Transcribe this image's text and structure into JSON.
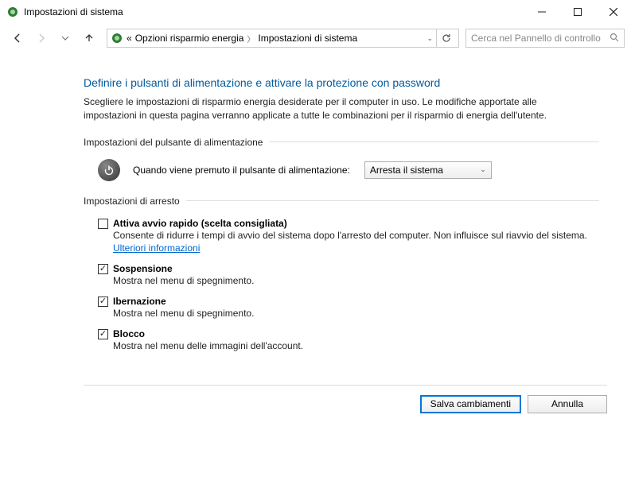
{
  "window": {
    "title": "Impostazioni di sistema"
  },
  "breadcrumb": {
    "prefix": "«",
    "item1": "Opzioni risparmio energia",
    "item2": "Impostazioni di sistema"
  },
  "search": {
    "placeholder": "Cerca nel Pannello di controllo"
  },
  "heading": "Definire i pulsanti di alimentazione e attivare la protezione con password",
  "description": "Scegliere le impostazioni di risparmio energia desiderate per il computer in uso. Le modifiche apportate alle impostazioni in questa pagina verranno applicate a tutte le combinazioni per il risparmio di energia dell'utente.",
  "section_power": {
    "header": "Impostazioni del pulsante di alimentazione",
    "label": "Quando viene premuto il pulsante di alimentazione:",
    "value": "Arresta il sistema"
  },
  "section_shutdown": {
    "header": "Impostazioni di arresto",
    "options": [
      {
        "title": "Attiva avvio rapido (scelta consigliata)",
        "desc": "Consente di ridurre i tempi di avvio del sistema dopo l'arresto del computer. Non influisce sul riavvio del sistema. ",
        "link": "Ulteriori informazioni",
        "checked": false
      },
      {
        "title": "Sospensione",
        "desc": "Mostra nel menu di spegnimento.",
        "checked": true
      },
      {
        "title": "Ibernazione",
        "desc": "Mostra nel menu di spegnimento.",
        "checked": true
      },
      {
        "title": "Blocco",
        "desc": "Mostra nel menu delle immagini dell'account.",
        "checked": true
      }
    ]
  },
  "footer": {
    "save": "Salva cambiamenti",
    "cancel": "Annulla"
  }
}
